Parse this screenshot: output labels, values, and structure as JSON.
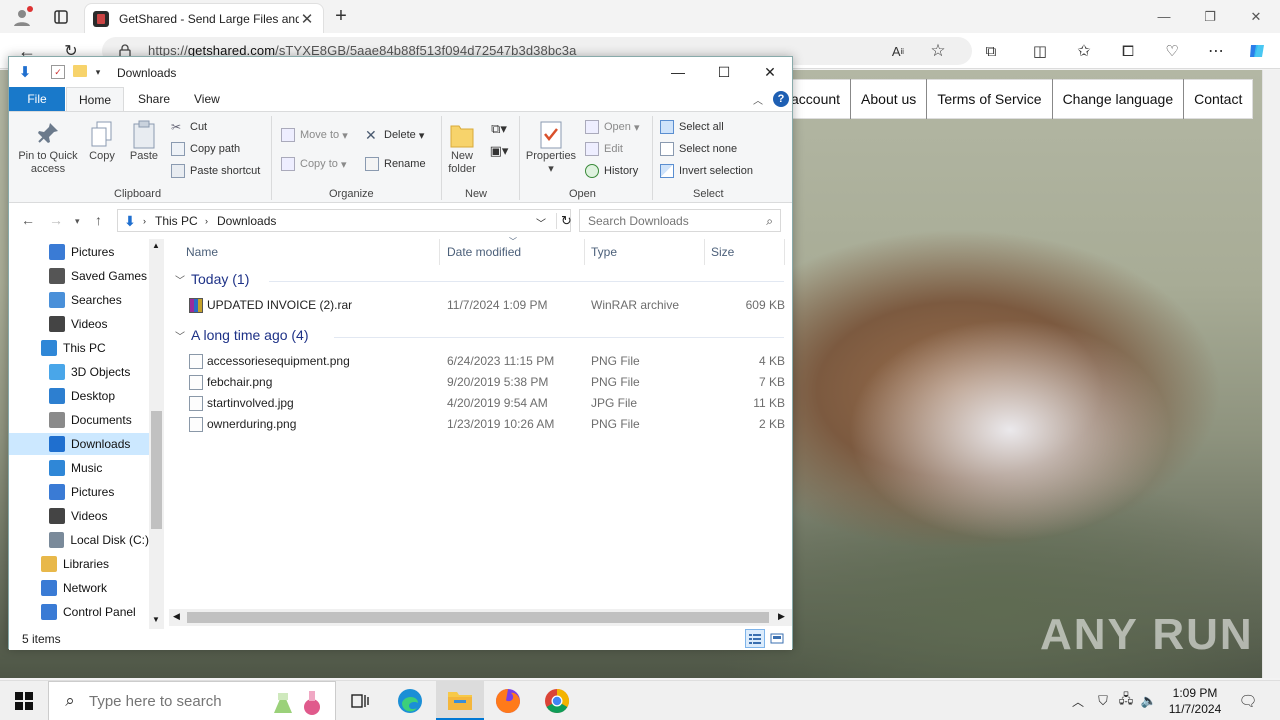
{
  "browser": {
    "tab_title": "GetShared - Send Large Files and",
    "url_scheme": "https://",
    "url_host": "getshared.com",
    "url_path": "/sTYXE8GB/5aae84b88f513f094d72547b3d38bc3a"
  },
  "site_nav": {
    "items": [
      "account",
      "About us",
      "Terms of Service",
      "Change language",
      "Contact"
    ]
  },
  "watermark": "ANY RUN",
  "explorer": {
    "title": "Downloads",
    "ribbon_tabs": [
      "File",
      "Home",
      "Share",
      "View"
    ],
    "clipboard": {
      "pin": "Pin to Quick access",
      "copy": "Copy",
      "paste": "Paste",
      "cut": "Cut",
      "copy_path": "Copy path",
      "paste_shortcut": "Paste shortcut",
      "label": "Clipboard"
    },
    "organize": {
      "move_to": "Move to",
      "copy_to": "Copy to",
      "delete": "Delete",
      "rename": "Rename",
      "label": "Organize"
    },
    "new": {
      "new_folder": "New folder",
      "label": "New"
    },
    "open": {
      "properties": "Properties",
      "open": "Open",
      "edit": "Edit",
      "history": "History",
      "label": "Open"
    },
    "select": {
      "select_all": "Select all",
      "select_none": "Select none",
      "invert": "Invert selection",
      "label": "Select"
    },
    "breadcrumb": [
      "This PC",
      "Downloads"
    ],
    "search_placeholder": "Search Downloads",
    "nav_pane": [
      {
        "label": "Pictures",
        "icon": "pictures-icon",
        "color": "#3a7bd5"
      },
      {
        "label": "Saved Games",
        "icon": "saved-games-icon",
        "color": "#555"
      },
      {
        "label": "Searches",
        "icon": "searches-icon",
        "color": "#4a90d9"
      },
      {
        "label": "Videos",
        "icon": "videos-icon",
        "color": "#444"
      },
      {
        "label": "This PC",
        "icon": "this-pc-icon",
        "color": "#2f87d7"
      },
      {
        "label": "3D Objects",
        "icon": "3d-objects-icon",
        "color": "#49a6e9"
      },
      {
        "label": "Desktop",
        "icon": "desktop-icon",
        "color": "#2d7fd0"
      },
      {
        "label": "Documents",
        "icon": "documents-icon",
        "color": "#8a8a8a"
      },
      {
        "label": "Downloads",
        "icon": "downloads-icon",
        "color": "#1f6fcf"
      },
      {
        "label": "Music",
        "icon": "music-icon",
        "color": "#2f87d7"
      },
      {
        "label": "Pictures",
        "icon": "pictures-icon",
        "color": "#3a7bd5"
      },
      {
        "label": "Videos",
        "icon": "videos-icon",
        "color": "#444"
      },
      {
        "label": "Local Disk (C:)",
        "icon": "local-disk-icon",
        "color": "#7a8a9a"
      },
      {
        "label": "Libraries",
        "icon": "libraries-icon",
        "color": "#e8b84a"
      },
      {
        "label": "Network",
        "icon": "network-icon",
        "color": "#3a7bd5"
      },
      {
        "label": "Control Panel",
        "icon": "control-panel-icon",
        "color": "#3a7bd5"
      }
    ],
    "columns": [
      "Name",
      "Date modified",
      "Type",
      "Size"
    ],
    "groups": [
      {
        "title": "Today (1)",
        "files": [
          {
            "name": "UPDATED INVOICE (2).rar",
            "date": "11/7/2024 1:09 PM",
            "type": "WinRAR archive",
            "size": "609 KB",
            "kind": "rar"
          }
        ]
      },
      {
        "title": "A long time ago (4)",
        "files": [
          {
            "name": "accessoriesequipment.png",
            "date": "6/24/2023 11:15 PM",
            "type": "PNG File",
            "size": "4 KB",
            "kind": "img"
          },
          {
            "name": "febchair.png",
            "date": "9/20/2019 5:38 PM",
            "type": "PNG File",
            "size": "7 KB",
            "kind": "img"
          },
          {
            "name": "startinvolved.jpg",
            "date": "4/20/2019 9:54 AM",
            "type": "JPG File",
            "size": "11 KB",
            "kind": "img"
          },
          {
            "name": "ownerduring.png",
            "date": "1/23/2019 10:26 AM",
            "type": "PNG File",
            "size": "2 KB",
            "kind": "img"
          }
        ]
      }
    ],
    "status": "5 items"
  },
  "taskbar": {
    "search_placeholder": "Type here to search",
    "time": "1:09 PM",
    "date": "11/7/2024"
  }
}
